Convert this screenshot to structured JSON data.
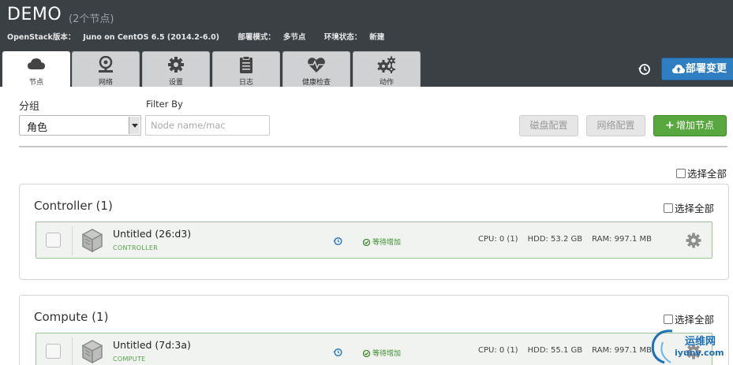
{
  "header": {
    "title": "DEMO",
    "subtitle": "(2个节点)",
    "openstack_label": "OpenStack版本：",
    "openstack_value": "Juno on CentOS 6.5 (2014.2-6.0)",
    "mode_label": "部署模式：",
    "mode_value": "多节点",
    "env_label": "环境状态：",
    "env_value": "新建"
  },
  "tabs": [
    {
      "label": "节点",
      "icon": "cloud-icon",
      "active": true
    },
    {
      "label": "网络",
      "icon": "network-icon",
      "active": false
    },
    {
      "label": "设置",
      "icon": "gear-icon",
      "active": false
    },
    {
      "label": "日志",
      "icon": "clipboard-icon",
      "active": false
    },
    {
      "label": "健康检查",
      "icon": "heartbeat-icon",
      "active": false
    },
    {
      "label": "动作",
      "icon": "cogs-icon",
      "active": false
    }
  ],
  "toolbar": {
    "deploy_label": "部署变更",
    "group_label": "分组",
    "group_selected": "角色",
    "filter_label": "Filter By",
    "filter_placeholder": "Node name/mac",
    "disk_config_label": "磁盘配置",
    "network_config_label": "网络配置",
    "add_nodes_label": "增加节点",
    "select_all_label": "选择全部"
  },
  "groups": [
    {
      "title": "Controller (1)",
      "select_all_label": "选择全部",
      "nodes": [
        {
          "name": "Untitled (26:d3)",
          "role": "CONTROLLER",
          "status": "等待增加",
          "cpu": "CPU: 0 (1)",
          "hdd": "HDD: 53.2 GB",
          "ram": "RAM: 997.1 MB"
        }
      ]
    },
    {
      "title": "Compute (1)",
      "select_all_label": "选择全部",
      "nodes": [
        {
          "name": "Untitled (7d:3a)",
          "role": "COMPUTE",
          "status": "等待增加",
          "cpu": "CPU: 0 (1)",
          "hdd": "HDD: 55.1 GB",
          "ram": "RAM: 997.1 MB"
        }
      ]
    }
  ],
  "watermark": {
    "line1": "运维网",
    "line2": "iyunv.com"
  },
  "colors": {
    "header_bg": "#3b4045",
    "primary": "#2f7ec1",
    "success": "#58a83f",
    "node_border": "#9ac495"
  }
}
